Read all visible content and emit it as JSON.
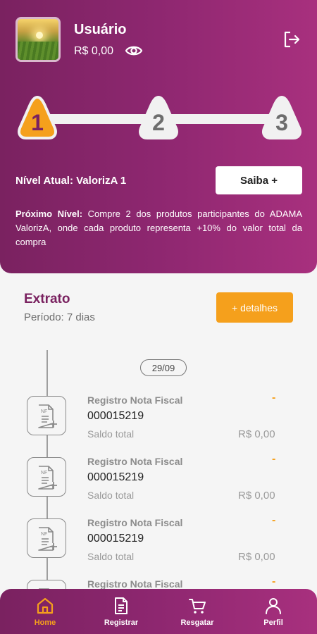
{
  "header": {
    "user_name": "Usuário",
    "balance": "R$ 0,00",
    "levels": [
      "1",
      "2",
      "3"
    ],
    "current_level": "Nível Atual: ValorizA 1",
    "about_button": "Saiba +",
    "next_level_label": "Próximo Nível:",
    "next_level_text": " Compre 2 dos produtos participantes do ADAMA ValorizA, onde cada produto representa +10% do valor total da compra"
  },
  "extrato": {
    "title": "Extrato",
    "period": "Período: 7 dias",
    "details_button": "+ detalhes",
    "date": "29/09",
    "entries": [
      {
        "title": "Registro Nota Fiscal",
        "number": "000015219",
        "saldo_label": "Saldo total",
        "saldo_value": "R$ 0,00",
        "status": "-"
      },
      {
        "title": "Registro Nota Fiscal",
        "number": "000015219",
        "saldo_label": "Saldo total",
        "saldo_value": "R$ 0,00",
        "status": "-"
      },
      {
        "title": "Registro Nota Fiscal",
        "number": "000015219",
        "saldo_label": "Saldo total",
        "saldo_value": "R$ 0,00",
        "status": "-"
      },
      {
        "title": "Registro Nota Fiscal",
        "number": "",
        "saldo_label": "",
        "saldo_value": "",
        "status": "-"
      }
    ],
    "nf_icon_label": "NF"
  },
  "nav": {
    "home": "Home",
    "register": "Registrar",
    "redeem": "Resgatar",
    "profile": "Perfil"
  },
  "colors": {
    "brand_purple": "#7a2260",
    "accent_orange": "#f5a01c",
    "background": "#f5f5f5"
  },
  "icons": [
    "eye-icon",
    "logout-icon",
    "nf-document-icon",
    "home-icon",
    "document-icon",
    "cart-icon",
    "user-icon"
  ]
}
